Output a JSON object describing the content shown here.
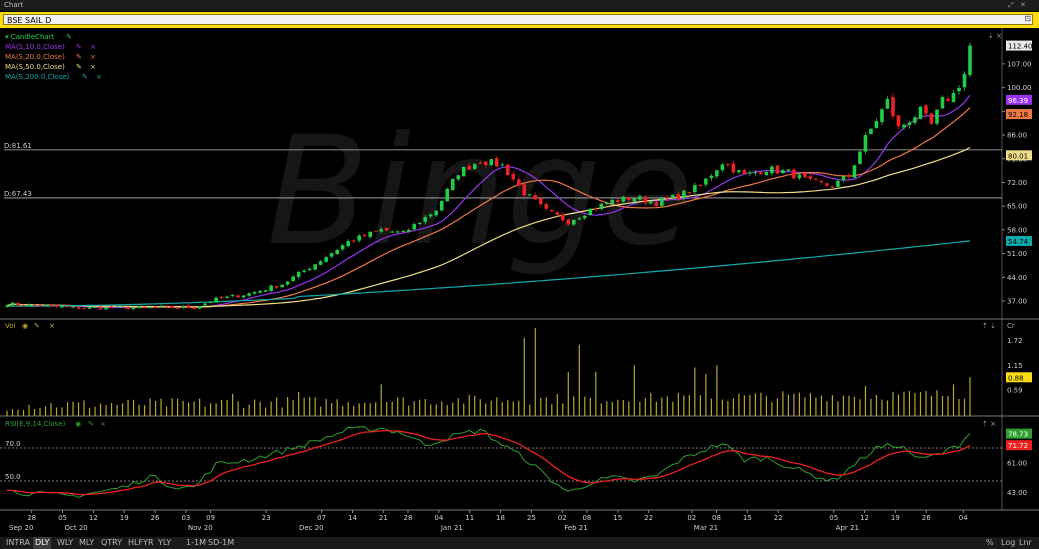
{
  "window": {
    "title": "Chart",
    "symbol": "BSE SAIL D"
  },
  "watermark": "Binge",
  "colors": {
    "up": "#22cc44",
    "down": "#ee2222",
    "ma10": "#9933ee",
    "ma20": "#ee7744",
    "ma50": "#eedd88",
    "ma200": "#11aaaa",
    "vol": "#b8a830",
    "rsi": "#2fa030",
    "rsi_signal": "#ee2020"
  },
  "legend": [
    {
      "label": "CandleChart",
      "color": "#22cc44",
      "icon": "triangle-down-icon"
    },
    {
      "label": "MA(S,10.0,Close)",
      "color": "#9933ee"
    },
    {
      "label": "MA(S,20.0,Close)",
      "color": "#ee7744"
    },
    {
      "label": "MA(S,50.0,Close)",
      "color": "#eedd88"
    },
    {
      "label": "MA(S,200.0,Close)",
      "color": "#11aaaa"
    }
  ],
  "panels": {
    "vol": {
      "label": "Vol",
      "unit": "Cr"
    },
    "rsi": {
      "label": "RSI(E,9,14,Close)"
    }
  },
  "bottom_bar": {
    "periods": [
      "INTRA",
      "DLY",
      "WLY",
      "MLY",
      "QTRY",
      "HLFYR",
      "YLY"
    ],
    "selected": "DLY",
    "ranges": [
      "1-1M",
      "SD-1M"
    ],
    "scales": [
      "Log",
      "Lnr"
    ]
  },
  "chart_data": [
    {
      "type": "candlestick",
      "panel": "price",
      "yticks": [
        "37.00",
        "44.00",
        "51.00",
        "58.00",
        "65.00",
        "72.00",
        "79.00",
        "86.00",
        "93.00",
        "100.00",
        "107.00"
      ],
      "ylim": [
        32.0,
        117.0
      ],
      "last_value": "112.40",
      "ma_labels": {
        "ma10": "96.39",
        "ma20": "92.18",
        "ma50": "80.01",
        "ma200": "54.74"
      },
      "hlines": [
        {
          "label": "D:81.61",
          "value": 81.61
        },
        {
          "label": "D:67.43",
          "value": 67.43
        }
      ],
      "close_anchors": [
        [
          0,
          36.2
        ],
        [
          12,
          35.0
        ],
        [
          24,
          35.1
        ],
        [
          34,
          35.2
        ],
        [
          38,
          37.5
        ],
        [
          44,
          39.2
        ],
        [
          50,
          42.0
        ],
        [
          56,
          48.0
        ],
        [
          62,
          54.5
        ],
        [
          68,
          58.0
        ],
        [
          72,
          57.0
        ],
        [
          78,
          64.0
        ],
        [
          82,
          75.0
        ],
        [
          86,
          78.5
        ],
        [
          90,
          77.0
        ],
        [
          94,
          69.0
        ],
        [
          98,
          63.5
        ],
        [
          102,
          60.5
        ],
        [
          106,
          64.0
        ],
        [
          110,
          66.5
        ],
        [
          114,
          67.5
        ],
        [
          118,
          66.0
        ],
        [
          122,
          68.0
        ],
        [
          126,
          71.0
        ],
        [
          130,
          78.0
        ],
        [
          134,
          74.0
        ],
        [
          138,
          76.0
        ],
        [
          142,
          75.0
        ],
        [
          146,
          72.0
        ],
        [
          150,
          71.0
        ],
        [
          153,
          74.0
        ],
        [
          156,
          85.0
        ],
        [
          160,
          96.0
        ],
        [
          162,
          88.0
        ],
        [
          166,
          93.0
        ],
        [
          168,
          89.0
        ],
        [
          170,
          96.0
        ],
        [
          172,
          98.0
        ],
        [
          174,
          104.0
        ],
        [
          175,
          112.4
        ]
      ],
      "ma_params": [
        10,
        20,
        50,
        200
      ],
      "ma200_range": [
        35.5,
        54.74
      ]
    },
    {
      "type": "bar",
      "panel": "volume",
      "yticks": [
        "0.59",
        "1.15",
        "1.72"
      ],
      "ylim": [
        0,
        2.0
      ],
      "last_value": "0.88",
      "spikes": [
        [
          94,
          1.78
        ],
        [
          96,
          2.0
        ],
        [
          104,
          1.62
        ],
        [
          114,
          1.15
        ],
        [
          125,
          1.1
        ],
        [
          129,
          1.15
        ],
        [
          41,
          0.5
        ],
        [
          53,
          0.55
        ],
        [
          68,
          0.72
        ],
        [
          102,
          1.0
        ],
        [
          107,
          1.0
        ],
        [
          127,
          0.95
        ],
        [
          156,
          0.68
        ],
        [
          172,
          0.72
        ],
        [
          175,
          0.88
        ]
      ]
    },
    {
      "type": "line",
      "panel": "rsi",
      "levels": [
        "70.0",
        "50.0"
      ],
      "yticks": [
        "61.00",
        "43.00"
      ],
      "ylim": [
        33,
        87
      ],
      "last_values": [
        "78.73",
        "71.72"
      ],
      "rsi_anchors": [
        [
          0,
          44.0
        ],
        [
          6,
          42.0
        ],
        [
          12,
          41.0
        ],
        [
          18,
          44.0
        ],
        [
          22,
          47.0
        ],
        [
          26,
          53.0
        ],
        [
          30,
          47.0
        ],
        [
          34,
          46.0
        ],
        [
          38,
          60.0
        ],
        [
          44,
          63.0
        ],
        [
          50,
          68.0
        ],
        [
          56,
          74.0
        ],
        [
          62,
          81.0
        ],
        [
          68,
          82.0
        ],
        [
          72,
          79.0
        ],
        [
          76,
          72.0
        ],
        [
          82,
          78.0
        ],
        [
          86,
          81.0
        ],
        [
          90,
          72.0
        ],
        [
          94,
          64.0
        ],
        [
          98,
          53.0
        ],
        [
          102,
          43.0
        ],
        [
          106,
          49.0
        ],
        [
          110,
          52.0
        ],
        [
          114,
          50.0
        ],
        [
          118,
          53.0
        ],
        [
          122,
          62.0
        ],
        [
          126,
          68.0
        ],
        [
          130,
          73.0
        ],
        [
          134,
          63.0
        ],
        [
          138,
          64.0
        ],
        [
          142,
          59.0
        ],
        [
          146,
          54.0
        ],
        [
          150,
          50.0
        ],
        [
          154,
          60.0
        ],
        [
          158,
          70.0
        ],
        [
          162,
          72.0
        ],
        [
          166,
          63.0
        ],
        [
          170,
          67.0
        ],
        [
          173,
          72.0
        ],
        [
          175,
          78.73
        ]
      ]
    }
  ],
  "x_axis": {
    "days": [
      {
        "label": "28",
        "i": 4
      },
      {
        "label": "05",
        "i": 9
      },
      {
        "label": "12",
        "i": 14
      },
      {
        "label": "19",
        "i": 19
      },
      {
        "label": "26",
        "i": 24
      },
      {
        "label": "03",
        "i": 29
      },
      {
        "label": "09",
        "i": 33
      },
      {
        "label": "23",
        "i": 42
      },
      {
        "label": "07",
        "i": 51
      },
      {
        "label": "14",
        "i": 56
      },
      {
        "label": "21",
        "i": 61
      },
      {
        "label": "28",
        "i": 65
      },
      {
        "label": "04",
        "i": 70
      },
      {
        "label": "11",
        "i": 75
      },
      {
        "label": "18",
        "i": 80
      },
      {
        "label": "25",
        "i": 85
      },
      {
        "label": "02",
        "i": 90
      },
      {
        "label": "08",
        "i": 94
      },
      {
        "label": "15",
        "i": 99
      },
      {
        "label": "22",
        "i": 104
      },
      {
        "label": "02",
        "i": 111
      },
      {
        "label": "08",
        "i": 115
      },
      {
        "label": "15",
        "i": 120
      },
      {
        "label": "22",
        "i": 125
      },
      {
        "label": "05",
        "i": 134
      },
      {
        "label": "12",
        "i": 139
      },
      {
        "label": "19",
        "i": 144
      },
      {
        "label": "26",
        "i": 149
      },
      {
        "label": "04",
        "i": 155
      }
    ],
    "months": [
      {
        "label": "Sep 20",
        "i": 0
      },
      {
        "label": "Oct 20",
        "i": 9
      },
      {
        "label": "Nov 20",
        "i": 29
      },
      {
        "label": "Dec 20",
        "i": 47
      },
      {
        "label": "Jan 21",
        "i": 70
      },
      {
        "label": "Feb 21",
        "i": 90
      },
      {
        "label": "Mar 21",
        "i": 111
      },
      {
        "label": "Apr 21",
        "i": 134
      }
    ]
  }
}
